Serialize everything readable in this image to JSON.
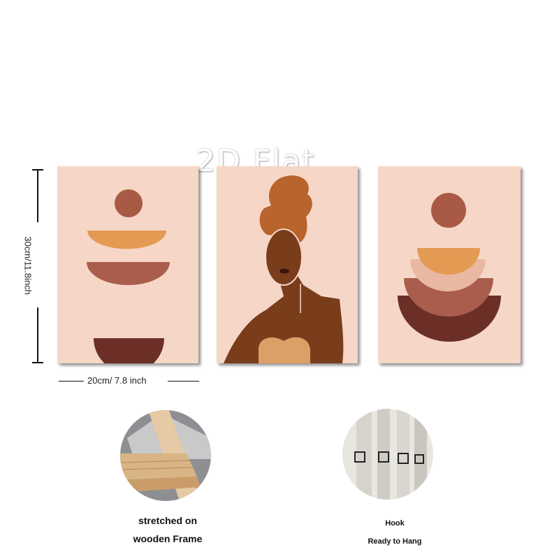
{
  "watermark": "2D Flat",
  "dimensions": {
    "height_label": "30cm/11.8inch",
    "width_label": "20cm/ 7.8 inch"
  },
  "panels": [
    {
      "name": "left-print",
      "subject": "stacked half circles and sun"
    },
    {
      "name": "center-print",
      "subject": "woman portrait"
    },
    {
      "name": "right-print",
      "subject": "rainbow arches and sun"
    }
  ],
  "features": [
    {
      "image": "wooden-frame-corner",
      "caption_lines": [
        "stretched on",
        "wooden Frame"
      ]
    },
    {
      "image": "hook-detail",
      "caption_lines": [
        "Hook",
        "Ready to Hang"
      ]
    }
  ],
  "colors": {
    "canvas_bg": "#f6d6c7",
    "terracotta": "#a95a45",
    "orange": "#e39a52",
    "brown": "#aa5d4d",
    "dark_brown": "#6b2f28",
    "skin": "#7a3d1c",
    "hair": "#b8642c",
    "top": "#dba066"
  }
}
